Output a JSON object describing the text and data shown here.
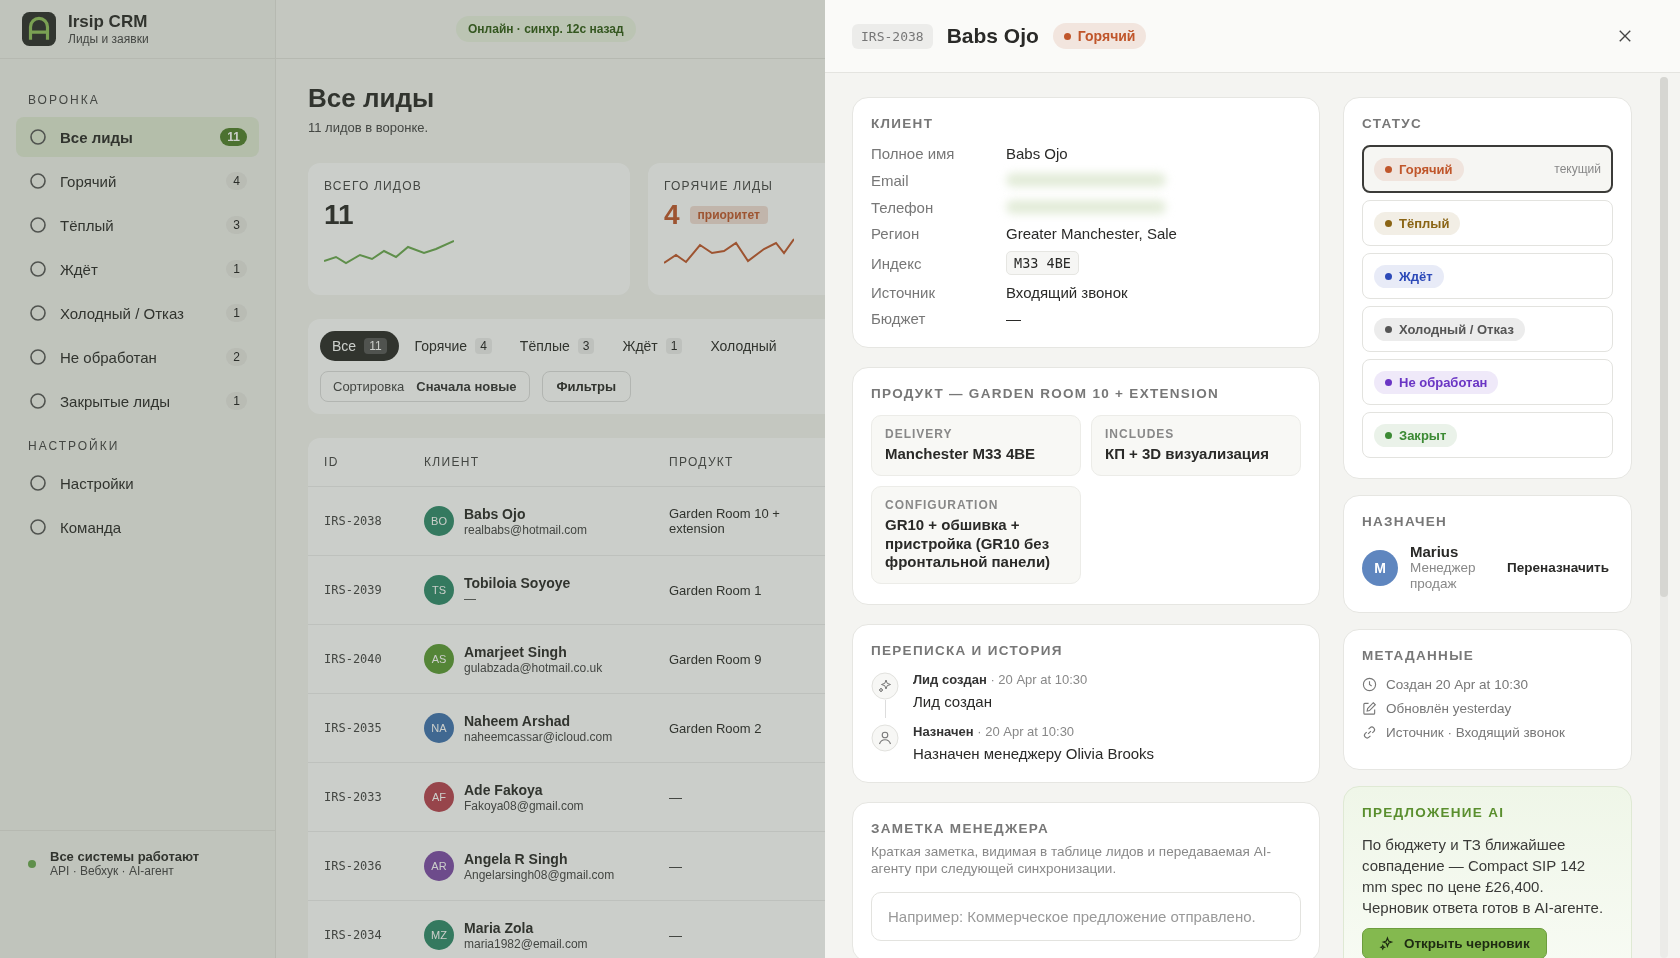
{
  "app": {
    "name": "Irsip CRM",
    "subtitle": "Лиды и заявки",
    "sync_status": "Онлайн · синхр. 12с назад"
  },
  "sidebar": {
    "sections": [
      {
        "title": "ВОРОНКА",
        "items": [
          {
            "label": "Все лиды",
            "count": "11",
            "selected": true
          },
          {
            "label": "Горячий",
            "count": "4",
            "selected": false
          },
          {
            "label": "Тёплый",
            "count": "3",
            "selected": false
          },
          {
            "label": "Ждёт",
            "count": "1",
            "selected": false
          },
          {
            "label": "Холодный / Отказ",
            "count": "1",
            "selected": false
          },
          {
            "label": "Не обработан",
            "count": "2",
            "selected": false
          },
          {
            "label": "Закрытые лиды",
            "count": "1",
            "selected": false
          }
        ]
      },
      {
        "title": "НАСТРОЙКИ",
        "items": [
          {
            "label": "Настройки",
            "selected": false
          },
          {
            "label": "Команда",
            "selected": false
          }
        ]
      }
    ],
    "footer": {
      "title": "Все системы работают",
      "subtitle": "API · Вебхук · AI-агент"
    }
  },
  "page": {
    "title": "Все лиды",
    "subtitle": "11 лидов в воронке.",
    "stats": [
      {
        "label": "ВСЕГО ЛИДОВ",
        "value": "11"
      },
      {
        "label": "ГОРЯЧИЕ ЛИДЫ",
        "value": "4",
        "badge": "приоритет"
      }
    ],
    "filter_tabs": [
      {
        "label": "Все",
        "count": "11",
        "selected": true
      },
      {
        "label": "Горячие",
        "count": "4",
        "selected": false
      },
      {
        "label": "Тёплые",
        "count": "3",
        "selected": false
      },
      {
        "label": "Ждёт",
        "count": "1",
        "selected": false
      },
      {
        "label": "Холодный",
        "selected": false
      }
    ],
    "sort": {
      "label": "Сортировка",
      "value": "Сначала новые"
    },
    "filters_button": "Фильтры",
    "table": {
      "columns": [
        "ID",
        "КЛИЕНТ",
        "ПРОДУКТ"
      ],
      "rows": [
        {
          "id": "IRS-2038",
          "initials": "BO",
          "name": "Babs Ojo",
          "email": "realbabs@hotmail.com",
          "product": "Garden Room 10 + extension"
        },
        {
          "id": "IRS-2039",
          "initials": "TS",
          "name": "Tobiloia Soyoye",
          "email": "—",
          "product": "Garden Room 1"
        },
        {
          "id": "IRS-2040",
          "initials": "AS",
          "name": "Amarjeet Singh",
          "email": "gulabzada@hotmail.co.uk",
          "product": "Garden Room 9"
        },
        {
          "id": "IRS-2035",
          "initials": "NA",
          "name": "Naheem Arshad",
          "email": "naheemcassar@icloud.com",
          "product": "Garden Room 2"
        },
        {
          "id": "IRS-2033",
          "initials": "AF",
          "name": "Ade Fakoya",
          "email": "Fakoya08@gmail.com",
          "product": "—"
        },
        {
          "id": "IRS-2036",
          "initials": "AR",
          "name": "Angela R Singh",
          "email": "Angelarsingh08@gmail.com",
          "product": "—"
        },
        {
          "id": "IRS-2034",
          "initials": "MZ",
          "name": "Maria Zola",
          "email": "maria1982@email.com",
          "product": "—"
        }
      ]
    }
  },
  "drawer": {
    "lead_id": "IRS-2038",
    "name": "Babs Ojo",
    "status_badge": {
      "label": "Горячий",
      "color": "#c0562b"
    },
    "client": {
      "title": "КЛИЕНТ",
      "fields": [
        {
          "label": "Полное имя",
          "value": "Babs Ojo",
          "kind": "text"
        },
        {
          "label": "Email",
          "kind": "hidden"
        },
        {
          "label": "Телефон",
          "kind": "hidden"
        },
        {
          "label": "Регион",
          "value": "Greater Manchester, Sale",
          "kind": "text"
        },
        {
          "label": "Индекс",
          "value": "M33 4BE",
          "kind": "code"
        },
        {
          "label": "Источник",
          "value": "Входящий звонок",
          "kind": "text"
        },
        {
          "label": "Бюджет",
          "value": "—",
          "kind": "text"
        }
      ]
    },
    "product": {
      "title": "ПРОДУКТ — GARDEN ROOM 10 + EXTENSION",
      "tiles": [
        {
          "label": "DELIVERY",
          "value": "Manchester M33 4BE"
        },
        {
          "label": "INCLUDES",
          "value": "КП + 3D визуализация"
        },
        {
          "label": "CONFIGURATION",
          "value": "GR10 + обшивка + пристройка (GR10 без фронтальной панели)"
        }
      ]
    },
    "history": {
      "title": "ПЕРЕПИСКА И ИСТОРИЯ",
      "events": [
        {
          "title": "Лид создан",
          "separator": "·",
          "time": "20 Apr at 10:30",
          "text": "Лид создан"
        },
        {
          "title": "Назначен",
          "separator": "·",
          "time": "20 Apr at 10:30",
          "text": "Назначен менеджеру Olivia Brooks"
        }
      ]
    },
    "note": {
      "title": "ЗАМЕТКА МЕНЕДЖЕРА",
      "description": "Краткая заметка, видимая в таблице лидов и передаваемая AI-агенту при следующей синхронизации.",
      "placeholder": "Например: Коммерческое предложение отправлено."
    },
    "status": {
      "title": "СТАТУС",
      "current_label": "текущий",
      "options": [
        {
          "label": "Горячий",
          "color": "#c0562b",
          "selected": true
        },
        {
          "label": "Тёплый",
          "color": "#8a6414",
          "selected": false
        },
        {
          "label": "Ждёт",
          "color": "#2c49b8",
          "selected": false
        },
        {
          "label": "Холодный / Отказ",
          "color": "#555555",
          "selected": false
        },
        {
          "label": "Не обработан",
          "color": "#6a35c4",
          "selected": false
        },
        {
          "label": "Закрыт",
          "color": "#3c8a34",
          "selected": false
        }
      ]
    },
    "assigned": {
      "title": "НАЗНАЧЕН",
      "initial": "M",
      "name": "Marius",
      "role": "Менеджер продаж",
      "action": "Переназначить"
    },
    "metadata": {
      "title": "МЕТАДАННЫЕ",
      "items": [
        "Создан 20 Apr at 10:30",
        "Обновлён yesterday",
        "Источник · Входящий звонок"
      ]
    },
    "ai": {
      "title": "ПРЕДЛОЖЕНИЕ AI",
      "text": "По бюджету и ТЗ ближайшее совпадение — Compact SIP 142 mm spec по цене £26,400. Черновик ответа готов в AI-агенте.",
      "button": "Открыть черновик"
    }
  }
}
